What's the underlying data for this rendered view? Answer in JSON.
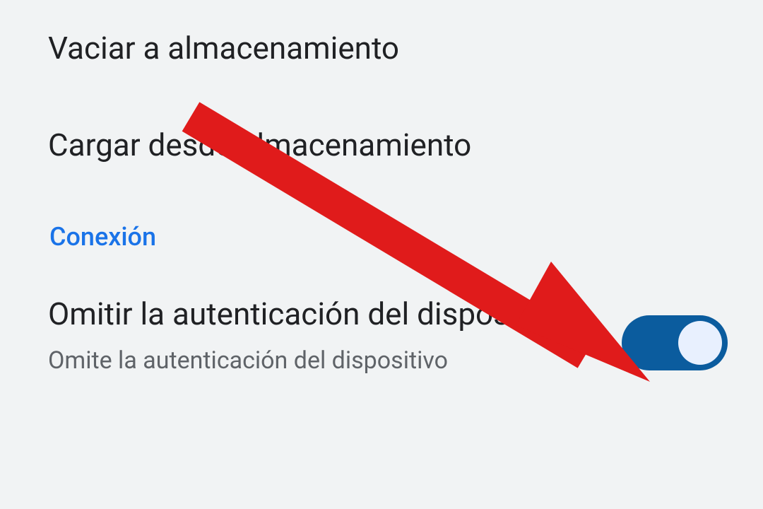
{
  "items": {
    "clear_storage": {
      "title": "Vaciar a almacenamiento"
    },
    "load_storage": {
      "title": "Cargar desde almacenamiento"
    }
  },
  "section": {
    "connection": {
      "title": "Conexión"
    }
  },
  "toggles": {
    "skip_auth": {
      "title": "Omitir la autenticación del dispositivo",
      "subtitle": "Omite la autenticación del dispositivo",
      "on": true
    }
  },
  "colors": {
    "accent": "#1a73e8",
    "toggle_on_bg": "#0b5c9e",
    "arrow": "#e01b1b"
  }
}
